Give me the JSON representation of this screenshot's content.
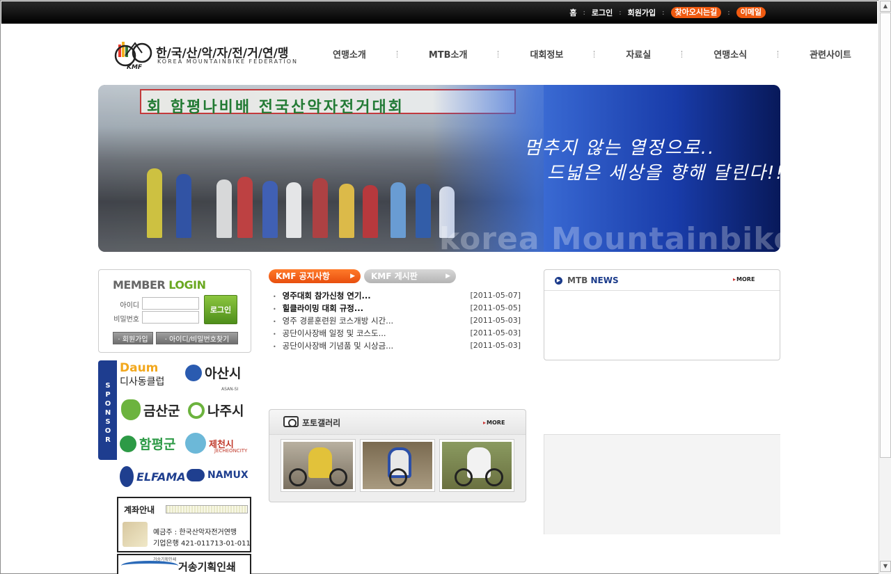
{
  "toplinks": {
    "home": "홈",
    "login": "로그인",
    "join": "회원가입",
    "directions": "찾아오시는길",
    "email": "이메일"
  },
  "logo": {
    "korean": "한/국/산/악/자/전/거/연/맹",
    "english": "KOREA MOUNTAINBIKE FEDERATION",
    "abbr": "KMF"
  },
  "nav": [
    "연맹소개",
    "MTB소개",
    "대회정보",
    "자료실",
    "연맹소식",
    "관련사이트"
  ],
  "banner": {
    "sign": "회 함평나비배 전국산악자전거대회",
    "slogan_line1": "멈추지 않는 열정으로..",
    "slogan_line2": "드넓은 세상을 향해 달린다!!",
    "watermark": "korea Mountainbike"
  },
  "login": {
    "title_member": "MEMBER",
    "title_login": "LOGIN",
    "id_label": "아이디",
    "pw_label": "비밀번호",
    "submit": "로그인",
    "join": "· 회원가입",
    "find": "· 아이디/비밀번호찾기"
  },
  "sponsor": {
    "tab": "SPONSOR",
    "items": [
      "디사동클럽",
      "아산시",
      "금산군",
      "나주시",
      "함평군",
      "제천시",
      "ELFAMA",
      "NAMUX"
    ],
    "daum": "Daum",
    "asan_en": "ASAN-SI",
    "jecheon_en": "JECHEONCITY"
  },
  "account": {
    "title": "계좌안내",
    "holder": "예금주 : 한국산악자전거연맹",
    "bank": "기업은행  421-011713-01-011"
  },
  "print": {
    "small": "거송기획인쇄",
    "name": "거송기획인쇄"
  },
  "tabs": {
    "notice": "KMF 공지사항",
    "board": "KMF 게시판"
  },
  "notices": [
    {
      "title": "영주대회 참가신청 연기...",
      "date": "[2011-05-07]",
      "bold": true
    },
    {
      "title": "힐클라이밍 대회 규정...",
      "date": "[2011-05-05]",
      "bold": true
    },
    {
      "title": "영주 경륜훈련원 코스개방 시간...",
      "date": "[2011-05-03]",
      "bold": false
    },
    {
      "title": "공단이사장배 일정 및 코스도...",
      "date": "[2011-05-03]",
      "bold": false
    },
    {
      "title": "공단이사장배 기념품 및 시상금...",
      "date": "[2011-05-03]",
      "bold": false
    }
  ],
  "gallery": {
    "title": "포토갤러리",
    "more": "MORE"
  },
  "news": {
    "title_mtb": "MTB",
    "title_news": "NEWS",
    "more": "MORE"
  },
  "colors": {
    "accent_orange": "#f05a10",
    "login_green": "#6aa821",
    "navy": "#1a3a8a"
  }
}
